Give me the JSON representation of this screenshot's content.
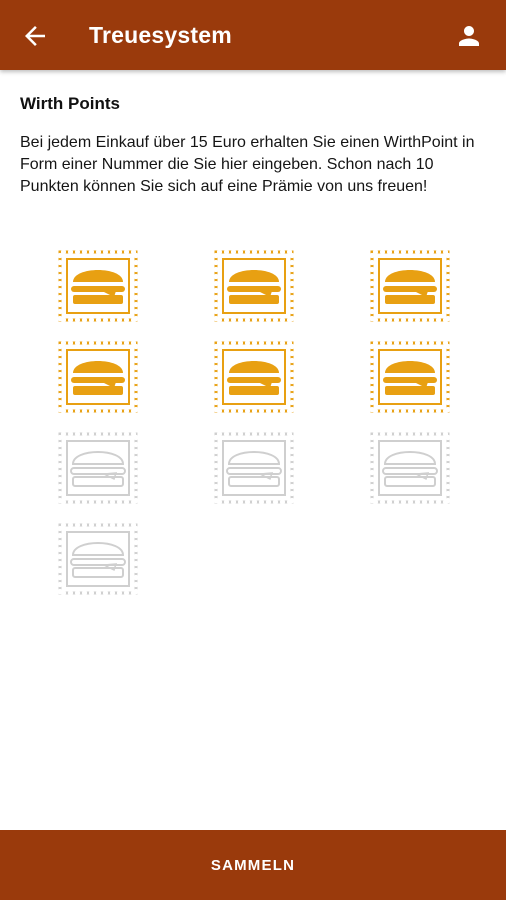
{
  "app_bar": {
    "title": "Treuesystem",
    "back_icon": "arrow-left-icon",
    "profile_icon": "person-icon"
  },
  "colors": {
    "primary": "#9a3a0c",
    "stamp_filled": "#e8a012",
    "stamp_empty": "#cfcfcf"
  },
  "content": {
    "heading": "Wirth Points",
    "description": "Bei jedem Einkauf über 15 Euro erhalten Sie einen WirthPoint in Form einer Nummer die Sie hier eingeben. Schon nach 10 Punkten können Sie sich auf eine Prämie von uns freuen!"
  },
  "stamps": {
    "total": 10,
    "collected": 6,
    "icon": "burger-stamp-icon"
  },
  "action": {
    "label": "SAMMELN"
  }
}
